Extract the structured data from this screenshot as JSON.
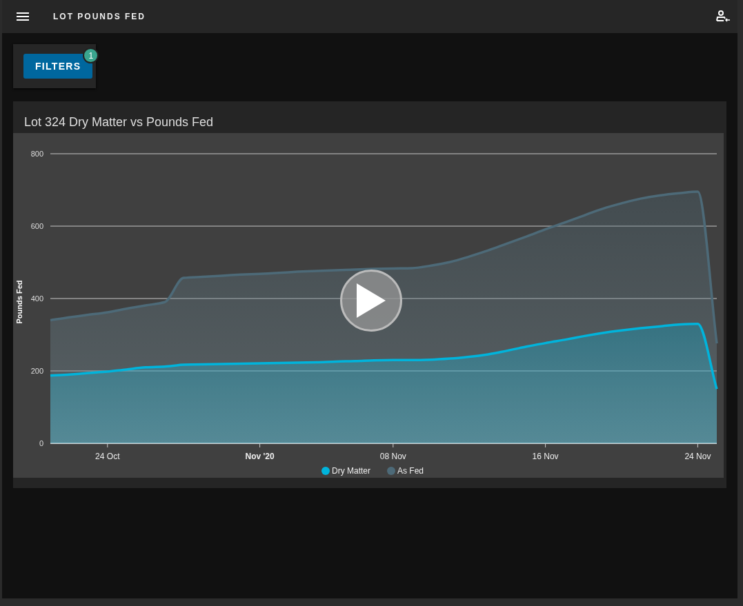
{
  "header": {
    "title": "LOT POUNDS FED"
  },
  "filters": {
    "label": "FILTERS",
    "badge": "1"
  },
  "chart_card": {
    "title": "Lot 324 Dry Matter vs Pounds Fed",
    "chart_data": {
      "type": "area",
      "ylabel": "Pounds Fed",
      "stacked": false,
      "categories": [
        null,
        null,
        null,
        "24 Oct",
        null,
        null,
        null,
        null,
        null,
        null,
        null,
        "**Nov '20**",
        null,
        null,
        null,
        null,
        null,
        null,
        "08 Nov",
        null,
        null,
        null,
        null,
        null,
        null,
        null,
        "16 Nov",
        null,
        null,
        null,
        null,
        null,
        null,
        null,
        "24 Nov",
        null
      ],
      "series": [
        {
          "name": "Dry Matter",
          "color": "#00b4dc",
          "values": [
            187,
            190,
            194,
            198,
            204,
            210,
            212,
            217,
            218,
            219,
            220,
            221,
            222,
            223,
            224,
            226,
            227,
            229,
            230,
            230,
            231,
            234,
            239,
            246,
            256,
            267,
            277,
            286,
            296,
            305,
            312,
            318,
            323,
            328,
            330,
            150
          ]
        },
        {
          "name": "As Fed",
          "color": "#4d6a78",
          "values": [
            340,
            348,
            355,
            362,
            372,
            381,
            390,
            457,
            460,
            463,
            466,
            468,
            471,
            474,
            476,
            478,
            480,
            482,
            483,
            484,
            491,
            501,
            516,
            533,
            552,
            571,
            591,
            610,
            629,
            648,
            663,
            676,
            685,
            691,
            695,
            276
          ]
        }
      ],
      "ylim": [
        0,
        800
      ],
      "grid": true,
      "legend": "bottom",
      "yticks": [
        0,
        200,
        400,
        600,
        800
      ]
    }
  }
}
